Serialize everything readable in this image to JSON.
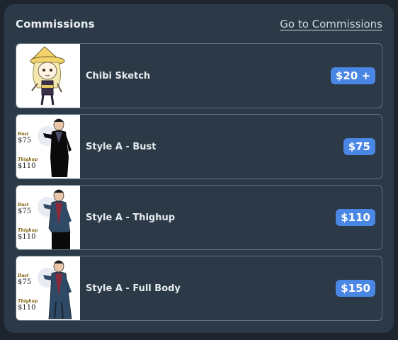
{
  "header": {
    "title": "Commissions",
    "link_label": "Go to Commissions"
  },
  "commissions": [
    {
      "title": "Chibi Sketch",
      "price": "$20 +",
      "thumb": "chibi-sketch-thumbnail"
    },
    {
      "title": "Style A - Bust",
      "price": "$75",
      "thumb": "style-a-bust-thumbnail",
      "note_bust_label": "Bust",
      "note_bust_price": "$75",
      "note_thigh_label": "Thighup",
      "note_thigh_price": "$110"
    },
    {
      "title": "Style A - Thighup",
      "price": "$110",
      "thumb": "style-a-thighup-thumbnail",
      "note_bust_label": "Bust",
      "note_bust_price": "$75",
      "note_thigh_label": "Thighup",
      "note_thigh_price": "$110"
    },
    {
      "title": "Style A - Full Body",
      "price": "$150",
      "thumb": "style-a-full-body-thumbnail",
      "note_bust_label": "Bust",
      "note_bust_price": "$75",
      "note_thigh_label": "Thighup",
      "note_thigh_price": "$110"
    }
  ],
  "colors": {
    "panel_bg": "#2b3a46",
    "badge_bg": "#4a86e3",
    "card_border": "#5d7384"
  }
}
